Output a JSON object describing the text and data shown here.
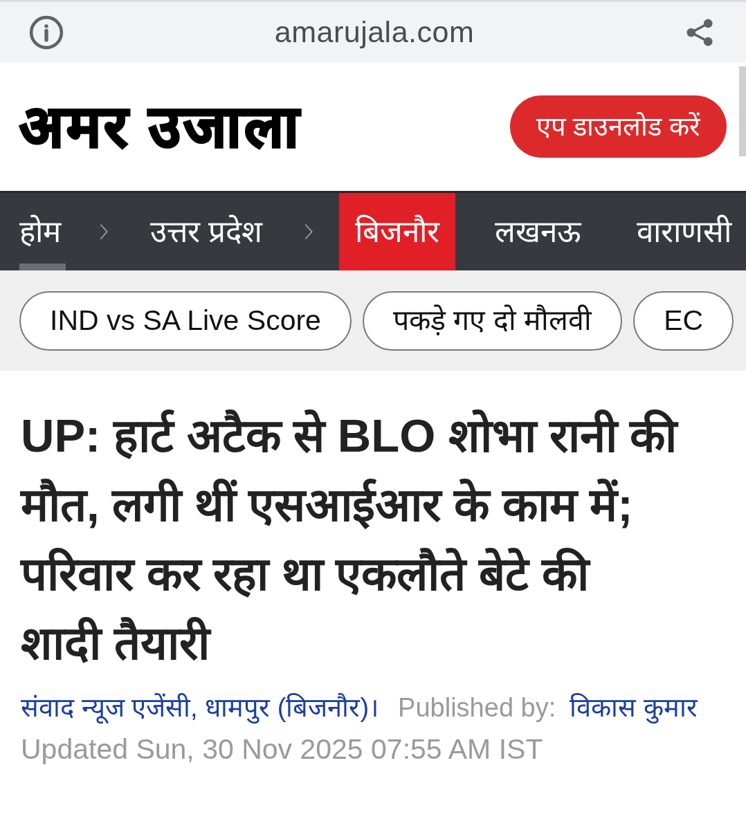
{
  "browser_bar": {
    "url": "amarujala.com"
  },
  "header": {
    "logo": "अमर उजाला",
    "app_button": "एप डाउनलोड करें"
  },
  "nav": {
    "items": [
      {
        "label": "होम",
        "kind": "breadcrumb",
        "selected": false,
        "underlined": true
      },
      {
        "label": "उत्तर प्रदेश",
        "kind": "breadcrumb",
        "selected": false,
        "underlined": false
      },
      {
        "label": "बिजनौर",
        "kind": "city",
        "selected": true,
        "underlined": false
      },
      {
        "label": "लखनऊ",
        "kind": "city",
        "selected": false,
        "underlined": false
      },
      {
        "label": "वाराणसी",
        "kind": "city",
        "selected": false,
        "underlined": false
      }
    ]
  },
  "trending": [
    "IND vs SA Live Score",
    "पकड़े गए दो मौलवी",
    "EC"
  ],
  "article": {
    "headline": "UP: हार्ट अटैक से BLO शोभा रानी की मौत, लगी थीं एसआईआर के काम में; परिवार कर रहा था एकलौते बेटे की शादी तैयारी",
    "byline": {
      "source": "संवाद न्यूज एजेंसी, धामपुर (बिजनौर)।",
      "published_label": "Published by:",
      "author": "विकास कुमार"
    },
    "updated": "Updated Sun, 30 Nov 2025 07:55 AM IST"
  }
}
